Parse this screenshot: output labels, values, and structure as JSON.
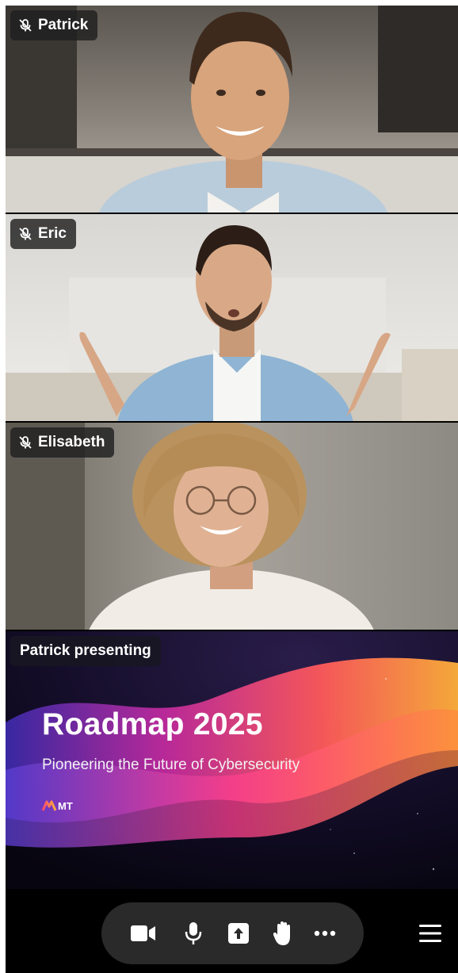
{
  "participants": [
    {
      "name": "Patrick",
      "muted": true
    },
    {
      "name": "Eric",
      "muted": true
    },
    {
      "name": "Elisabeth",
      "muted": true
    }
  ],
  "presentation": {
    "badge": "Patrick presenting",
    "title": "Roadmap 2025",
    "subtitle": "Pioneering the Future of Cybersecurity",
    "logo_text": "MT"
  },
  "controls": {
    "icons": [
      "video-camera-icon",
      "microphone-icon",
      "share-screen-icon",
      "raise-hand-icon",
      "more-options-icon",
      "hamburger-menu-icon"
    ]
  },
  "colors": {
    "bar_background": "#000000",
    "pill_background": "#2a2a2a",
    "badge_background": "#202020"
  }
}
